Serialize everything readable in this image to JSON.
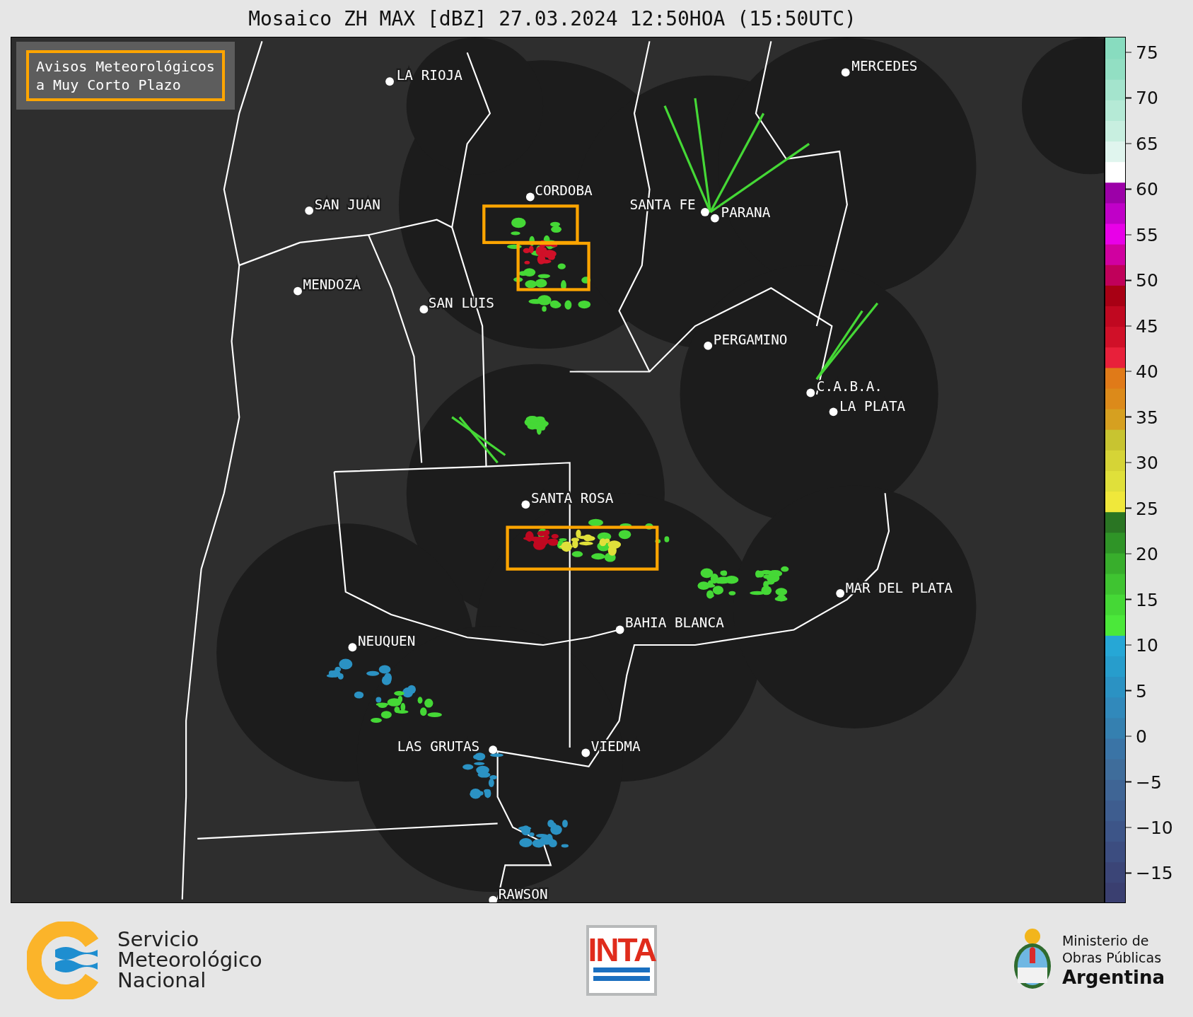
{
  "title": "Mosaico ZH MAX [dBZ] 27.03.2024 12:50HOA (15:50UTC)",
  "map": {
    "legend_box": [
      "Avisos Meteorológicos",
      "a Muy Corto Plazo"
    ],
    "cities": [
      {
        "name": "LA RIOJA"
      },
      {
        "name": "MERCEDES"
      },
      {
        "name": "CORDOBA"
      },
      {
        "name": "SAN JUAN"
      },
      {
        "name": "SANTA FE"
      },
      {
        "name": "PARANA"
      },
      {
        "name": "MENDOZA"
      },
      {
        "name": "SAN LUIS"
      },
      {
        "name": "PERGAMINO"
      },
      {
        "name": "C.A.B.A."
      },
      {
        "name": "LA PLATA"
      },
      {
        "name": "SANTA ROSA"
      },
      {
        "name": "MAR DEL PLATA"
      },
      {
        "name": "BAHIA BLANCA"
      },
      {
        "name": "NEUQUEN"
      },
      {
        "name": "LAS GRUTAS"
      },
      {
        "name": "VIEDMA"
      },
      {
        "name": "RAWSON"
      }
    ]
  },
  "colorbar": {
    "ticks": [
      "75",
      "70",
      "65",
      "60",
      "55",
      "50",
      "45",
      "40",
      "35",
      "30",
      "25",
      "20",
      "15",
      "10",
      "5",
      "0",
      "−5",
      "−10",
      "−15"
    ]
  },
  "footer": {
    "smn": [
      "Servicio",
      "Meteorológico",
      "Nacional"
    ],
    "inta": "INTA",
    "ministry": [
      "Ministerio de",
      "Obras Públicas",
      "Argentina"
    ]
  }
}
